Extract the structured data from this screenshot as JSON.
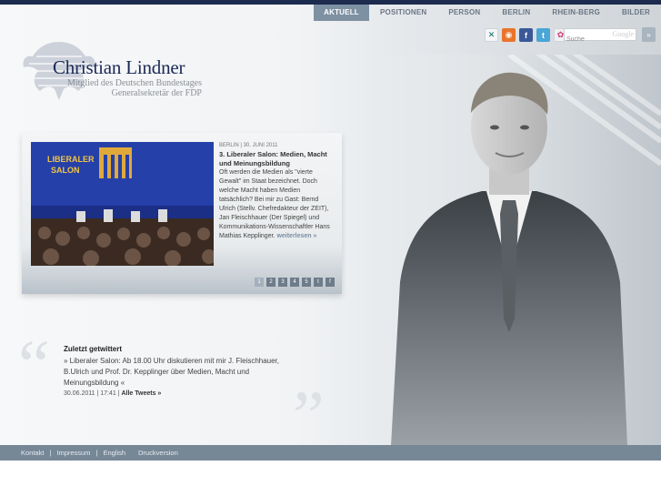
{
  "nav": {
    "items": [
      {
        "label": "AKTUELL",
        "active": true
      },
      {
        "label": "POSITIONEN",
        "active": false
      },
      {
        "label": "PERSON",
        "active": false
      },
      {
        "label": "BERLIN",
        "active": false
      },
      {
        "label": "RHEIN-BERG",
        "active": false
      },
      {
        "label": "BILDER",
        "active": false
      }
    ]
  },
  "social": {
    "icons": [
      "xing-icon",
      "rss-icon",
      "facebook-icon",
      "twitter-icon",
      "flickr-icon"
    ]
  },
  "search": {
    "placeholder": "Suche",
    "brand": "Google"
  },
  "logo": {
    "name": "Christian Lindner",
    "subtitle1": "Mitglied des Deutschen Bundestages",
    "subtitle2": "Generalsekretär der FDP"
  },
  "news": {
    "photo_banner_line1": "LIBERALER",
    "photo_banner_line2": "SALON",
    "meta": "BERLIN | 30. JUNI 2011",
    "title": "3. Liberaler Salon: Medien, Macht und Meinungsbildung",
    "text": "Oft werden die Medien als \"vierte Gewalt\" im Staat bezeichnet. Doch welche Macht haben Medien tatsächlich? Bei mir zu Gast: Bernd Ulrich (Stellv. Chefredakteur der ZEIT), Jan Fleischhauer (Der Spiegel) und Kommunikations-Wissenschaftler Hans Mathias Kepplinger.",
    "more": "weiterlesen »",
    "pages": [
      "1",
      "2",
      "3",
      "4",
      "5"
    ],
    "active_page": "1"
  },
  "tweet": {
    "heading": "Zuletzt getwittert",
    "text": "» Liberaler Salon: Ab 18.00 Uhr diskutieren mit mir J. Fleischhauer, B.Ulrich und Prof. Dr. Kepplinger über Medien, Macht und Meinungsbildung «",
    "timestamp": "30.06.2011 | 17:41 |",
    "all_link": "Alle Tweets »"
  },
  "footer": {
    "links": [
      "Kontakt",
      "Impressum",
      "English",
      "Druckversion"
    ]
  },
  "colors": {
    "brand_navy": "#1b2a55",
    "nav_active": "#7e91a3",
    "footer": "#768796"
  }
}
